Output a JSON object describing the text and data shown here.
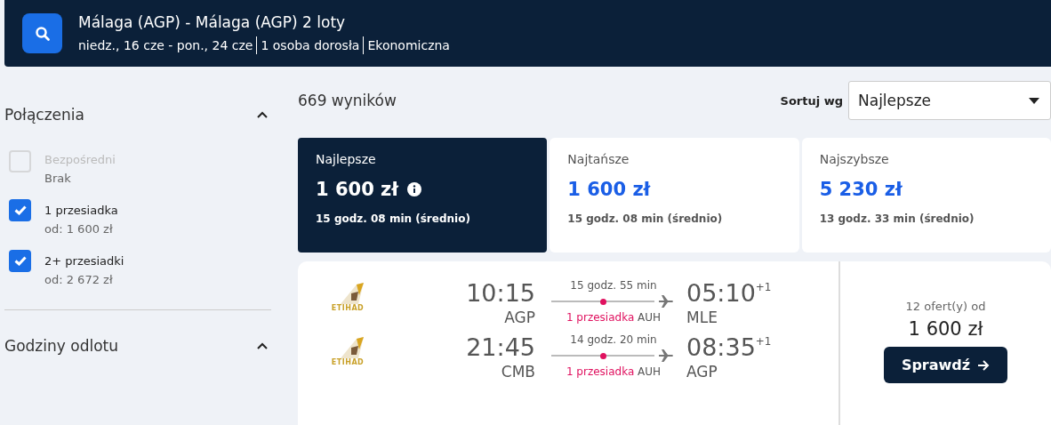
{
  "header": {
    "title": "Málaga (AGP) - Málaga (AGP) 2 loty",
    "details": [
      "niedz., 16 cze - pon., 24 cze",
      "1 osoba dorosła",
      "Ekonomiczna"
    ]
  },
  "filters": [
    {
      "title": "Połączenia",
      "expanded": true,
      "options": [
        {
          "label": "Bezpośredni",
          "sub": "Brak",
          "checked": false,
          "disabled": true
        },
        {
          "label": "1 przesiadka",
          "sub": "od: 1 600 zł",
          "checked": true,
          "disabled": false
        },
        {
          "label": "2+ przesiadki",
          "sub": "od: 2 672 zł",
          "checked": true,
          "disabled": false
        }
      ]
    },
    {
      "title": "Godziny odlotu",
      "expanded": true
    }
  ],
  "results_count": "669 wyników",
  "sort": {
    "label": "Sortuj wg",
    "value": "Najlepsze"
  },
  "tabs": [
    {
      "label": "Najlepsze",
      "price": "1 600 zł",
      "duration": "15 godz. 08 min (średnio)",
      "selected": true,
      "info": true
    },
    {
      "label": "Najtańsze",
      "price": "1 600 zł",
      "duration": "15 godz. 08 min (średnio)",
      "selected": false,
      "info": false
    },
    {
      "label": "Najszybsze",
      "price": "5 230 zł",
      "duration": "13 godz. 33 min (średnio)",
      "selected": false,
      "info": false
    }
  ],
  "result": {
    "legs": [
      {
        "airline": "ETIHAD",
        "dep_time": "10:15",
        "dep_airport": "AGP",
        "duration": "15 godz. 55 min",
        "stops": "1 przesiadka",
        "via": "AUH",
        "arr_time": "05:10",
        "day_offset": "+1",
        "arr_airport": "MLE"
      },
      {
        "airline": "ETIHAD",
        "dep_time": "21:45",
        "dep_airport": "CMB",
        "duration": "14 godz. 20 min",
        "stops": "1 przesiadka",
        "via": "AUH",
        "arr_time": "08:35",
        "day_offset": "+1",
        "arr_airport": "AGP"
      }
    ],
    "offers": "12 ofert(y) od",
    "price": "1 600 zł",
    "button": "Sprawdź"
  }
}
